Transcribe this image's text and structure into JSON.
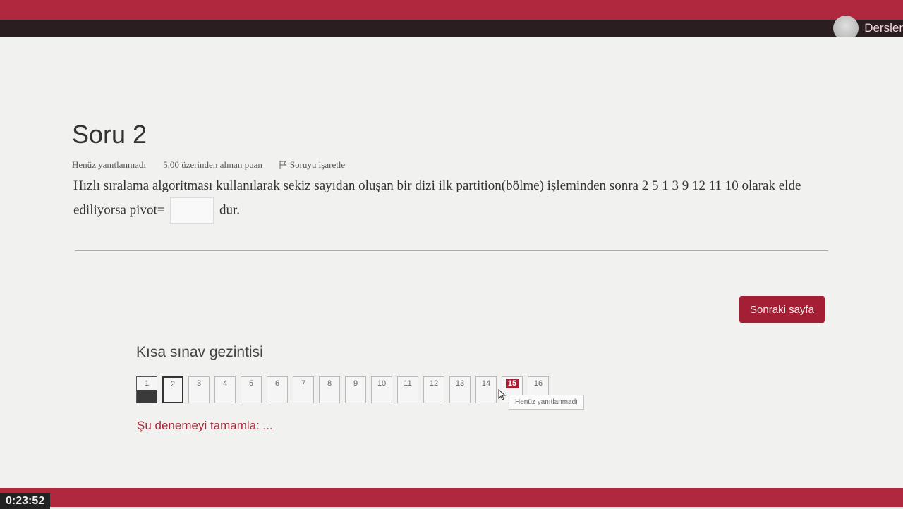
{
  "header": {
    "user_label": "Dersler"
  },
  "question": {
    "title": "Soru 2",
    "status": "Henüz yanıtlanmadı",
    "points": "5.00 üzerinden alınan puan",
    "flag_label": "Soruyu işaretle",
    "text_part1": "Hızlı sıralama algoritması kullanılarak sekiz sayıdan oluşan bir dizi ilk partition(bölme) işleminden sonra 2 5 1 3 9 12 11 10 olarak elde ediliyorsa pivot=",
    "answer_value": "",
    "text_part2": "dur."
  },
  "next_button_label": "Sonraki sayfa",
  "navigation": {
    "title": "Kısa sınav gezintisi",
    "questions": [
      "1",
      "2",
      "3",
      "4",
      "5",
      "6",
      "7",
      "8",
      "9",
      "10",
      "11",
      "12",
      "13",
      "14",
      "15",
      "16"
    ],
    "answered_index": 0,
    "current_index": 1,
    "highlight_index": 14,
    "tooltip": "Henüz yanıtlanmadı",
    "finish_link": "Şu denemeyi tamamla: ..."
  },
  "timer": "0:23:52",
  "colors": {
    "brand": "#b0283d",
    "button": "#a41f33"
  }
}
